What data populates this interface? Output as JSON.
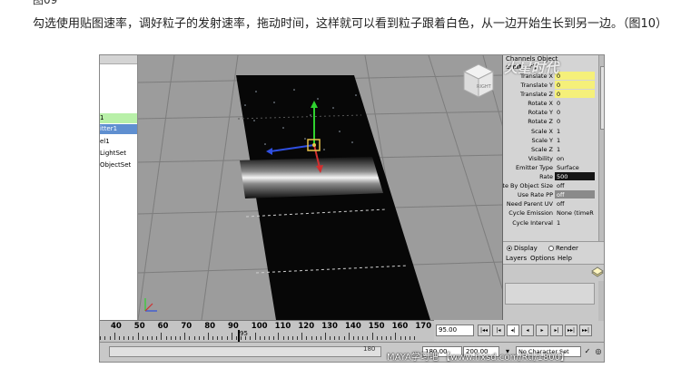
{
  "article": {
    "prev_caption": "图09",
    "caption": "勾选使用贴图速率，调好粒子的发射速率，拖动时间，这样就可以看到粒子跟着白色，从一边开始生长到另一边。（图10）"
  },
  "outliner": {
    "items": [
      {
        "label": "1"
      },
      {
        "label": "itter1"
      },
      {
        "label": "el1"
      },
      {
        "label": "LightSet"
      },
      {
        "label": "ObjectSet"
      }
    ]
  },
  "viewport": {
    "view_cube_label": "RIGHT",
    "accent_color": "#e8c24a"
  },
  "channel_box": {
    "tabs": "Channels  Object",
    "object_name": "emitter1",
    "attributes": [
      {
        "label": "Translate X",
        "value": "0",
        "style": "y"
      },
      {
        "label": "Translate Y",
        "value": "0",
        "style": "y"
      },
      {
        "label": "Translate Z",
        "value": "0",
        "style": "y"
      },
      {
        "label": "Rotate X",
        "value": "0",
        "style": ""
      },
      {
        "label": "Rotate Y",
        "value": "0",
        "style": ""
      },
      {
        "label": "Rotate Z",
        "value": "0",
        "style": ""
      },
      {
        "label": "Scale X",
        "value": "1",
        "style": ""
      },
      {
        "label": "Scale Y",
        "value": "1",
        "style": ""
      },
      {
        "label": "Scale Z",
        "value": "1",
        "style": ""
      },
      {
        "label": "Visibility",
        "value": "on",
        "style": ""
      },
      {
        "label": "Emitter Type",
        "value": "Surface",
        "style": ""
      },
      {
        "label": "Rate",
        "value": "500",
        "style": "dark"
      },
      {
        "label": "te By Object Size",
        "value": "off",
        "style": ""
      },
      {
        "label": "Use Rate PP",
        "value": "off",
        "style": "gray"
      },
      {
        "label": "Need Parent UV",
        "value": "off",
        "style": ""
      },
      {
        "label": "Cycle Emission",
        "value": "None (timeR",
        "style": ""
      },
      {
        "label": "Cycle Interval",
        "value": "1",
        "style": ""
      }
    ]
  },
  "mode": {
    "display_label": "Display",
    "render_label": "Render"
  },
  "layers_menu": {
    "layers": "Layers",
    "options": "Options",
    "help": "Help"
  },
  "timeline": {
    "ticks": [
      "40",
      "50",
      "60",
      "70",
      "80",
      "90",
      "100",
      "110",
      "120",
      "130",
      "140",
      "150",
      "160",
      "170"
    ],
    "current_frame": "95"
  },
  "frame_field": "95.00",
  "playback": [
    "|◂◂",
    "|◂",
    "◂|",
    "◂",
    "▸",
    "▸|",
    "▸▸|",
    "▸▸|"
  ],
  "range": {
    "start_field": "180.00",
    "end_field": "200.00",
    "slider_end": "180",
    "character_set": "No Character Set"
  },
  "watermarks": {
    "top": "火星时代",
    "bottom": "MAYA学习吧 【www.hxsd.com/Rtl/1800】"
  }
}
